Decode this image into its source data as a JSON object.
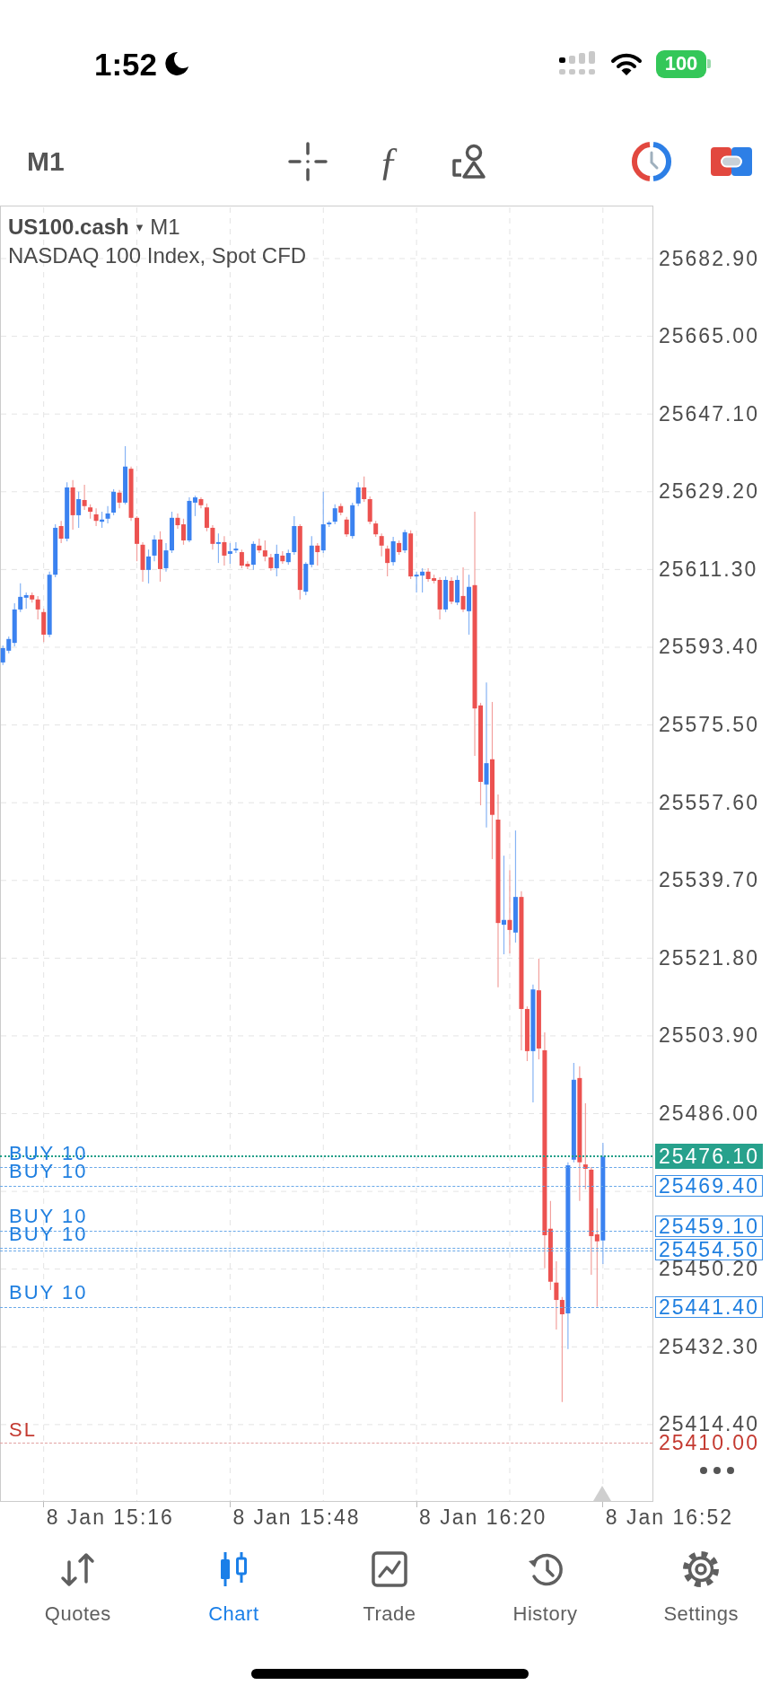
{
  "status_bar": {
    "time": "1:52",
    "battery": "100"
  },
  "toolbar": {
    "timeframe": "M1",
    "function_glyph": "ƒ"
  },
  "chart": {
    "symbol": "US100.cash",
    "caret": "▾",
    "timeframe": "M1",
    "description": "NASDAQ 100 Index, Spot CFD",
    "chart_data": {
      "type": "candlestick",
      "grid": true,
      "categories": [
        null,
        null,
        null,
        null,
        null,
        null,
        null,
        null,
        null,
        null,
        null,
        null,
        null,
        null,
        null,
        null,
        null,
        null,
        null,
        null,
        null,
        null,
        null,
        null,
        null,
        null,
        null,
        null,
        null,
        null,
        null,
        null,
        null,
        null,
        null,
        null,
        null,
        null,
        null,
        null,
        null,
        null,
        null,
        null,
        null,
        null,
        null,
        null,
        null,
        null,
        null,
        null,
        null,
        null,
        null,
        null,
        null,
        null,
        null,
        null,
        null,
        null,
        null,
        null,
        null,
        null,
        null,
        null,
        null,
        null,
        null,
        null,
        null,
        null,
        null,
        null,
        null,
        null,
        null,
        null,
        null,
        null,
        null,
        null,
        null,
        null,
        null,
        null,
        null,
        null,
        null,
        null,
        null,
        null,
        null,
        null,
        null,
        null,
        null,
        null,
        null,
        null,
        null,
        null,
        null,
        null,
        null,
        null,
        null,
        null,
        null,
        null
      ],
      "ohlc": [
        [
          25589.9,
          25593.8,
          25589.3,
          25593.2
        ],
        [
          25592.6,
          25595.9,
          25592.0,
          25595.3
        ],
        [
          25594.4,
          25603.5,
          25593.6,
          25602.1
        ],
        [
          25602.1,
          25608.1,
          25601.5,
          25605.0
        ],
        [
          25604.8,
          25606.0,
          25602.3,
          25605.4
        ],
        [
          25605.4,
          25606.0,
          25603.7,
          25604.4
        ],
        [
          25604.4,
          25605.2,
          25599.8,
          25602.1
        ],
        [
          25601.5,
          25602.3,
          25594.6,
          25596.3
        ],
        [
          25596.3,
          25610.8,
          25595.7,
          25610.1
        ],
        [
          25610.1,
          25621.7,
          25609.5,
          25620.9
        ],
        [
          25621.3,
          25622.5,
          25617.4,
          25618.4
        ],
        [
          25618.4,
          25631.4,
          25617.8,
          25630.2
        ],
        [
          25630.2,
          25631.9,
          25620.5,
          25623.8
        ],
        [
          25623.8,
          25629.2,
          25620.9,
          25627.5
        ],
        [
          25627.3,
          25630.8,
          25625.0,
          25625.9
        ],
        [
          25625.6,
          25626.3,
          25623.0,
          25624.6
        ],
        [
          25624.0,
          25625.4,
          25621.3,
          25622.5
        ],
        [
          25622.3,
          25624.6,
          25620.9,
          25622.8
        ],
        [
          25623.0,
          25625.9,
          25621.9,
          25624.2
        ],
        [
          25624.4,
          25629.8,
          25623.8,
          25629.2
        ],
        [
          25629.0,
          25629.6,
          25625.4,
          25626.7
        ],
        [
          25626.7,
          25639.7,
          25626.3,
          25635.0
        ],
        [
          25634.5,
          25635.0,
          25622.5,
          25623.2
        ],
        [
          25623.2,
          25623.6,
          25613.2,
          25617.2
        ],
        [
          25617.0,
          25617.6,
          25608.5,
          25611.2
        ],
        [
          25611.2,
          25615.9,
          25608.1,
          25614.3
        ],
        [
          25614.5,
          25619.2,
          25613.2,
          25618.2
        ],
        [
          25618.2,
          25620.1,
          25608.5,
          25611.4
        ],
        [
          25611.6,
          25617.4,
          25610.8,
          25615.7
        ],
        [
          25615.7,
          25624.6,
          25615.1,
          25623.2
        ],
        [
          25623.2,
          25624.2,
          25620.7,
          25621.5
        ],
        [
          25621.7,
          25623.0,
          25617.0,
          25618.0
        ],
        [
          25618.0,
          25627.9,
          25617.6,
          25627.1
        ],
        [
          25626.7,
          25628.3,
          25623.6,
          25627.9
        ],
        [
          25627.5,
          25627.9,
          25625.4,
          25626.1
        ],
        [
          25625.6,
          25626.5,
          25620.1,
          25620.9
        ],
        [
          25620.9,
          25621.5,
          25615.9,
          25617.2
        ],
        [
          25617.2,
          25619.6,
          25612.8,
          25617.6
        ],
        [
          25617.6,
          25619.0,
          25612.2,
          25614.5
        ],
        [
          25614.9,
          25617.4,
          25612.6,
          25615.5
        ],
        [
          25615.7,
          25617.6,
          25615.1,
          25616.1
        ],
        [
          25615.3,
          25615.9,
          25611.6,
          25612.2
        ],
        [
          25612.6,
          25613.2,
          25611.4,
          25612.0
        ],
        [
          25612.4,
          25617.8,
          25611.2,
          25617.2
        ],
        [
          25616.8,
          25618.4,
          25615.1,
          25615.7
        ],
        [
          25615.7,
          25618.0,
          25613.2,
          25614.3
        ],
        [
          25614.1,
          25614.9,
          25611.0,
          25611.6
        ],
        [
          25611.6,
          25617.0,
          25609.7,
          25614.9
        ],
        [
          25614.5,
          25615.5,
          25612.6,
          25613.2
        ],
        [
          25613.0,
          25615.9,
          25612.4,
          25615.1
        ],
        [
          25615.3,
          25623.6,
          25614.7,
          25621.3
        ],
        [
          25621.3,
          25621.7,
          25604.4,
          25606.6
        ],
        [
          25606.2,
          25613.0,
          25605.4,
          25612.6
        ],
        [
          25612.4,
          25619.0,
          25611.8,
          25616.8
        ],
        [
          25616.8,
          25617.4,
          25612.2,
          25615.3
        ],
        [
          25615.7,
          25629.2,
          25615.1,
          25621.7
        ],
        [
          25621.7,
          25622.5,
          25621.1,
          25622.1
        ],
        [
          25622.3,
          25626.3,
          25621.7,
          25625.4
        ],
        [
          25625.9,
          25626.5,
          25623.8,
          25624.4
        ],
        [
          25622.8,
          25623.4,
          25618.8,
          25619.4
        ],
        [
          25619.0,
          25626.7,
          25618.4,
          25626.1
        ],
        [
          25626.5,
          25631.4,
          25625.9,
          25630.2
        ],
        [
          25630.2,
          25632.7,
          25626.9,
          25627.5
        ],
        [
          25627.5,
          25628.1,
          25621.7,
          25622.3
        ],
        [
          25621.9,
          25622.5,
          25618.8,
          25619.4
        ],
        [
          25619.0,
          25619.6,
          25614.3,
          25616.8
        ],
        [
          25616.1,
          25616.8,
          25609.7,
          25612.8
        ],
        [
          25613.0,
          25618.8,
          25612.2,
          25617.8
        ],
        [
          25617.4,
          25618.0,
          25614.7,
          25615.3
        ],
        [
          25615.7,
          25620.5,
          25615.1,
          25619.9
        ],
        [
          25619.6,
          25620.3,
          25609.1,
          25609.7
        ],
        [
          25609.7,
          25610.8,
          25606.0,
          25610.1
        ],
        [
          25609.9,
          25611.6,
          25606.0,
          25610.8
        ],
        [
          25610.8,
          25611.6,
          25608.5,
          25609.1
        ],
        [
          25609.3,
          25610.1,
          25608.1,
          25608.7
        ],
        [
          25608.9,
          25609.5,
          25599.8,
          25602.1
        ],
        [
          25602.1,
          25609.7,
          25601.5,
          25608.9
        ],
        [
          25608.7,
          25609.5,
          25603.3,
          25603.9
        ],
        [
          25603.7,
          25609.9,
          25603.1,
          25608.9
        ],
        [
          25605.2,
          25611.8,
          25601.5,
          25602.1
        ],
        [
          25601.7,
          25610.1,
          25596.3,
          25607.3
        ],
        [
          25607.7,
          25624.6,
          25568.4,
          25579.3
        ],
        [
          25580.0,
          25580.6,
          25557.0,
          25562.4
        ],
        [
          25561.8,
          25585.3,
          25551.9,
          25566.7
        ],
        [
          25567.6,
          25580.8,
          25544.6,
          25554.8
        ],
        [
          25553.7,
          25559.5,
          25515.1,
          25529.9
        ],
        [
          25529.5,
          25545.4,
          25522.7,
          25530.6
        ],
        [
          25530.6,
          25542.1,
          25522.9,
          25528.3
        ],
        [
          25527.7,
          25551.2,
          25525.4,
          25535.9
        ],
        [
          25535.9,
          25537.2,
          25500.6,
          25510.1
        ],
        [
          25510.1,
          25510.7,
          25498.1,
          25500.4
        ],
        [
          25500.4,
          25515.7,
          25488.6,
          25514.6
        ],
        [
          25514.4,
          25521.7,
          25498.5,
          25501.0
        ],
        [
          25500.6,
          25504.7,
          25450.4,
          25458.0
        ],
        [
          25459.5,
          25465.9,
          25445.4,
          25447.3
        ],
        [
          25447.1,
          25452.0,
          25436.3,
          25443.1
        ],
        [
          25443.1,
          25443.8,
          25419.6,
          25439.8
        ],
        [
          25440.0,
          25474.8,
          25431.8,
          25474.1
        ],
        [
          25475.4,
          25497.7,
          25474.8,
          25493.8
        ],
        [
          25494.2,
          25496.9,
          25465.9,
          25474.8
        ],
        [
          25474.3,
          25488.4,
          25468.6,
          25473.3
        ],
        [
          25473.1,
          25473.7,
          25448.9,
          25457.8
        ],
        [
          25458.2,
          25464.2,
          25441.5,
          25456.6
        ],
        [
          25456.8,
          25479.3,
          25451.4,
          25476.1
        ],
        null,
        null,
        null,
        null,
        null,
        null,
        null,
        null
      ],
      "ylim": [
        25396.6,
        25695.1
      ],
      "yticks": [
        {
          "value": 25682.9,
          "label": "25682.90"
        },
        {
          "value": 25665.0,
          "label": "25665.00"
        },
        {
          "value": 25647.1,
          "label": "25647.10"
        },
        {
          "value": 25629.2,
          "label": "25629.20"
        },
        {
          "value": 25611.3,
          "label": "25611.30"
        },
        {
          "value": 25593.4,
          "label": "25593.40"
        },
        {
          "value": 25575.5,
          "label": "25575.50"
        },
        {
          "value": 25557.6,
          "label": "25557.60"
        },
        {
          "value": 25539.7,
          "label": "25539.70"
        },
        {
          "value": 25521.8,
          "label": "25521.80"
        },
        {
          "value": 25503.9,
          "label": "25503.90"
        },
        {
          "value": 25486.0,
          "label": "25486.00"
        },
        {
          "value": 25450.2,
          "label": "25450.20"
        },
        {
          "value": 25432.3,
          "label": "25432.30"
        },
        {
          "value": 25414.4,
          "label": "25414.40"
        }
      ]
    },
    "time_labels": [
      "8 Jan 15:16",
      "8 Jan 15:48",
      "8 Jan 16:20",
      "8 Jan 16:52"
    ],
    "current_price": "25476.10",
    "orders": [
      {
        "kind": "buy",
        "label": "BUY 10"
      },
      {
        "kind": "buy",
        "label": "BUY 10",
        "price": "25469.40"
      },
      {
        "kind": "buy",
        "label": "BUY 10",
        "price": "25459.10"
      },
      {
        "kind": "buy",
        "label": "BUY 10",
        "price": "25454.50"
      },
      {
        "kind": "buy"
      },
      {
        "kind": "buy",
        "label": "BUY 10",
        "price": "25441.40"
      },
      {
        "kind": "stop_loss",
        "label": "SL",
        "price": "25410.00"
      }
    ]
  },
  "tabs": [
    {
      "label": "Quotes",
      "selected": false
    },
    {
      "label": "Chart",
      "selected": true
    },
    {
      "label": "Trade",
      "selected": false
    },
    {
      "label": "History",
      "selected": false
    },
    {
      "label": "Settings",
      "selected": false
    }
  ]
}
